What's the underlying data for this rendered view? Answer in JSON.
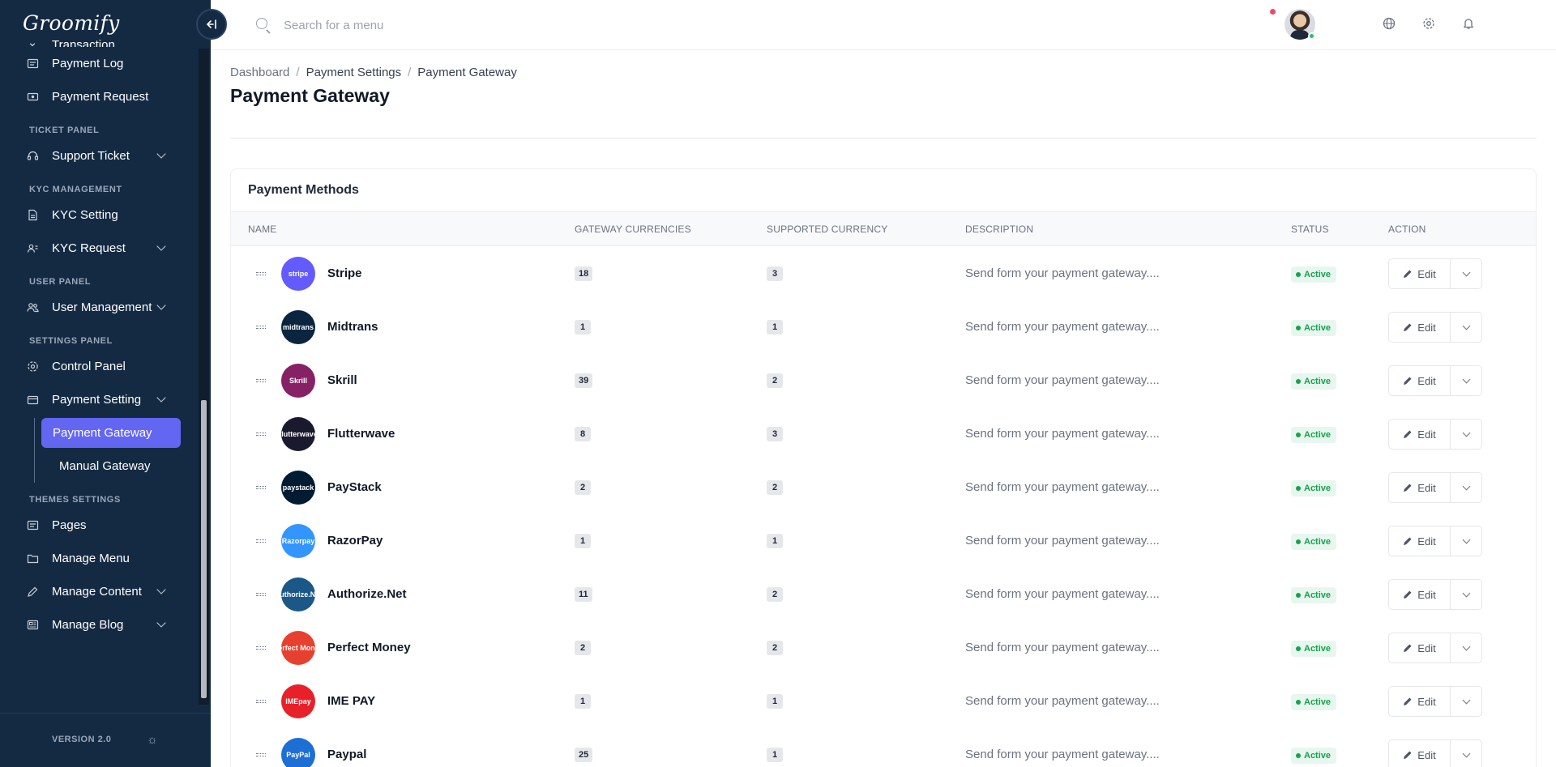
{
  "app": {
    "brand": "Groomify"
  },
  "sidebar": {
    "partial_item": "Transaction",
    "items": [
      {
        "type": "item",
        "label": "Payment Log",
        "icon": "list-icon"
      },
      {
        "type": "item",
        "label": "Payment Request",
        "icon": "money-icon"
      },
      {
        "type": "section",
        "label": "TICKET PANEL"
      },
      {
        "type": "item",
        "label": "Support Ticket",
        "icon": "headset-icon",
        "has_children": true
      },
      {
        "type": "section",
        "label": "KYC MANAGEMENT"
      },
      {
        "type": "item",
        "label": "KYC Setting",
        "icon": "document-icon"
      },
      {
        "type": "item",
        "label": "KYC Request",
        "icon": "user-card-icon",
        "has_children": true
      },
      {
        "type": "section",
        "label": "USER PANEL"
      },
      {
        "type": "item",
        "label": "User Management",
        "icon": "users-icon",
        "has_children": true
      },
      {
        "type": "section",
        "label": "SETTINGS PANEL"
      },
      {
        "type": "item",
        "label": "Control Panel",
        "icon": "gear-icon"
      },
      {
        "type": "item",
        "label": "Payment Setting",
        "icon": "wallet-icon",
        "has_children": true
      }
    ],
    "payment_setting_children": [
      {
        "label": "Payment Gateway",
        "active": true
      },
      {
        "label": "Manual Gateway",
        "active": false
      }
    ],
    "items_after": [
      {
        "type": "section",
        "label": "THEMES SETTINGS"
      },
      {
        "type": "item",
        "label": "Pages",
        "icon": "list-icon"
      },
      {
        "type": "item",
        "label": "Manage Menu",
        "icon": "folder-icon"
      },
      {
        "type": "item",
        "label": "Manage Content",
        "icon": "pencil-icon",
        "has_children": true
      },
      {
        "type": "item",
        "label": "Manage Blog",
        "icon": "newspaper-icon",
        "has_children": true
      }
    ],
    "version": "VERSION 2.0"
  },
  "topbar": {
    "search_placeholder": "Search for a menu"
  },
  "breadcrumb": [
    "Dashboard",
    "Payment Settings",
    "Payment Gateway"
  ],
  "page_title": "Payment Gateway",
  "card": {
    "title": "Payment Methods",
    "columns": [
      "NAME",
      "GATEWAY CURRENCIES",
      "SUPPORTED CURRENCY",
      "DESCRIPTION",
      "STATUS",
      "ACTION"
    ],
    "edit_label": "Edit",
    "rows": [
      {
        "name": "Stripe",
        "logo_text": "stripe",
        "logo_color": "#635bff",
        "gateway_currencies": "18",
        "supported_currency": "3",
        "description": "Send form your payment gateway....",
        "status": "Active"
      },
      {
        "name": "Midtrans",
        "logo_text": "midtrans",
        "logo_color": "#0b2540",
        "gateway_currencies": "1",
        "supported_currency": "1",
        "description": "Send form your payment gateway....",
        "status": "Active"
      },
      {
        "name": "Skrill",
        "logo_text": "Skrill",
        "logo_color": "#862165",
        "gateway_currencies": "39",
        "supported_currency": "2",
        "description": "Send form your payment gateway....",
        "status": "Active"
      },
      {
        "name": "Flutterwave",
        "logo_text": "flutterwave",
        "logo_color": "#1a1a2e",
        "gateway_currencies": "8",
        "supported_currency": "3",
        "description": "Send form your payment gateway....",
        "status": "Active"
      },
      {
        "name": "PayStack",
        "logo_text": "paystack",
        "logo_color": "#011b33",
        "gateway_currencies": "2",
        "supported_currency": "2",
        "description": "Send form your payment gateway....",
        "status": "Active"
      },
      {
        "name": "RazorPay",
        "logo_text": "Razorpay",
        "logo_color": "#3395ff",
        "gateway_currencies": "1",
        "supported_currency": "1",
        "description": "Send form your payment gateway....",
        "status": "Active"
      },
      {
        "name": "Authorize.Net",
        "logo_text": "Authorize.Net",
        "logo_color": "#1b5887",
        "gateway_currencies": "11",
        "supported_currency": "2",
        "description": "Send form your payment gateway....",
        "status": "Active"
      },
      {
        "name": "Perfect Money",
        "logo_text": "Perfect Money",
        "logo_color": "#e8402f",
        "gateway_currencies": "2",
        "supported_currency": "2",
        "description": "Send form your payment gateway....",
        "status": "Active"
      },
      {
        "name": "IME PAY",
        "logo_text": "IMEpay",
        "logo_color": "#e8202a",
        "gateway_currencies": "1",
        "supported_currency": "1",
        "description": "Send form your payment gateway....",
        "status": "Active"
      },
      {
        "name": "Paypal",
        "logo_text": "PayPal",
        "logo_color": "#1d6fd6",
        "gateway_currencies": "25",
        "supported_currency": "1",
        "description": "Send form your payment gateway....",
        "status": "Active"
      }
    ]
  }
}
